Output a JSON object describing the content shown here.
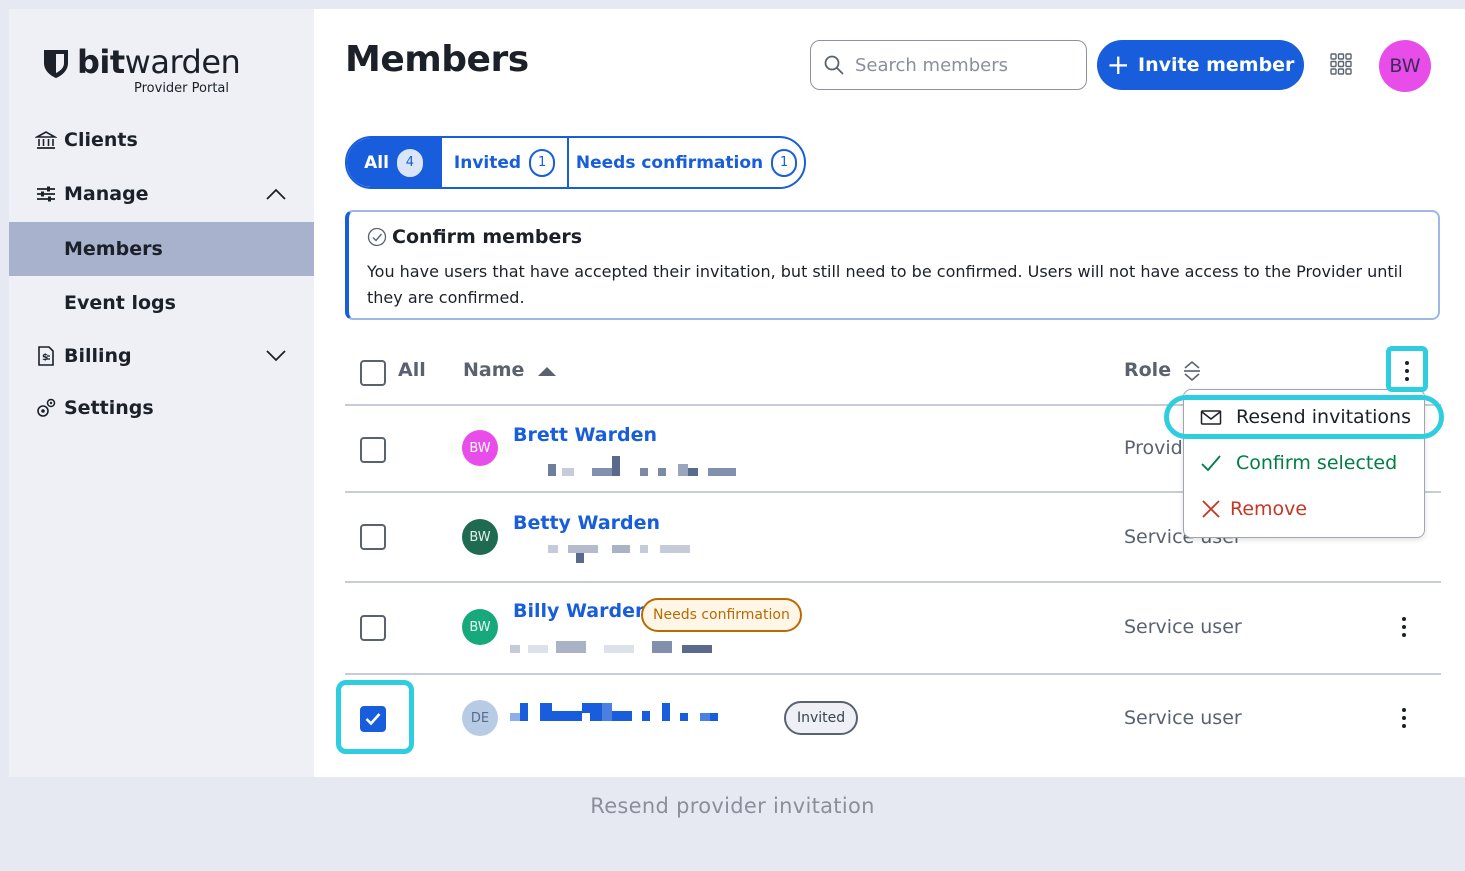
{
  "sidebar": {
    "logo_brand_bold": "bit",
    "logo_brand_light": "warden",
    "logo_sub": "Provider Portal",
    "items": [
      {
        "label": "Clients"
      },
      {
        "label": "Manage"
      },
      {
        "label": "Members"
      },
      {
        "label": "Event logs"
      },
      {
        "label": "Billing"
      },
      {
        "label": "Settings"
      }
    ]
  },
  "header": {
    "title": "Members",
    "search_placeholder": "Search members",
    "invite_label": "Invite member",
    "avatar_initials": "BW"
  },
  "tabs": [
    {
      "label": "All",
      "count": "4"
    },
    {
      "label": "Invited",
      "count": "1"
    },
    {
      "label": "Needs confirmation",
      "count": "1"
    }
  ],
  "callout": {
    "title": "Confirm members",
    "text": "You have users that have accepted their invitation, but still need to be confirmed. Users will not have access to the Provider until they are confirmed."
  },
  "table": {
    "col_all": "All",
    "col_name": "Name",
    "col_role": "Role",
    "rows": [
      {
        "initials": "BW",
        "name": "Brett Warden",
        "role": "Provid",
        "badge": "",
        "selected": false
      },
      {
        "initials": "BW",
        "name": "Betty Warden",
        "role": "Service user",
        "badge": "",
        "selected": false
      },
      {
        "initials": "BW",
        "name": "Billy Warden",
        "role": "Service user",
        "badge": "Needs confirmation",
        "selected": false
      },
      {
        "initials": "DE",
        "name": "",
        "role": "Service user",
        "badge": "Invited",
        "selected": true
      }
    ]
  },
  "menu": {
    "resend": "Resend invitations",
    "confirm": "Confirm selected",
    "remove": "Remove"
  },
  "caption": "Resend provider invitation",
  "colors": {
    "brand": "#175ddc",
    "highlight": "#2ecde0",
    "warning": "#b96a00",
    "success": "#017e45",
    "danger": "#c83522"
  }
}
